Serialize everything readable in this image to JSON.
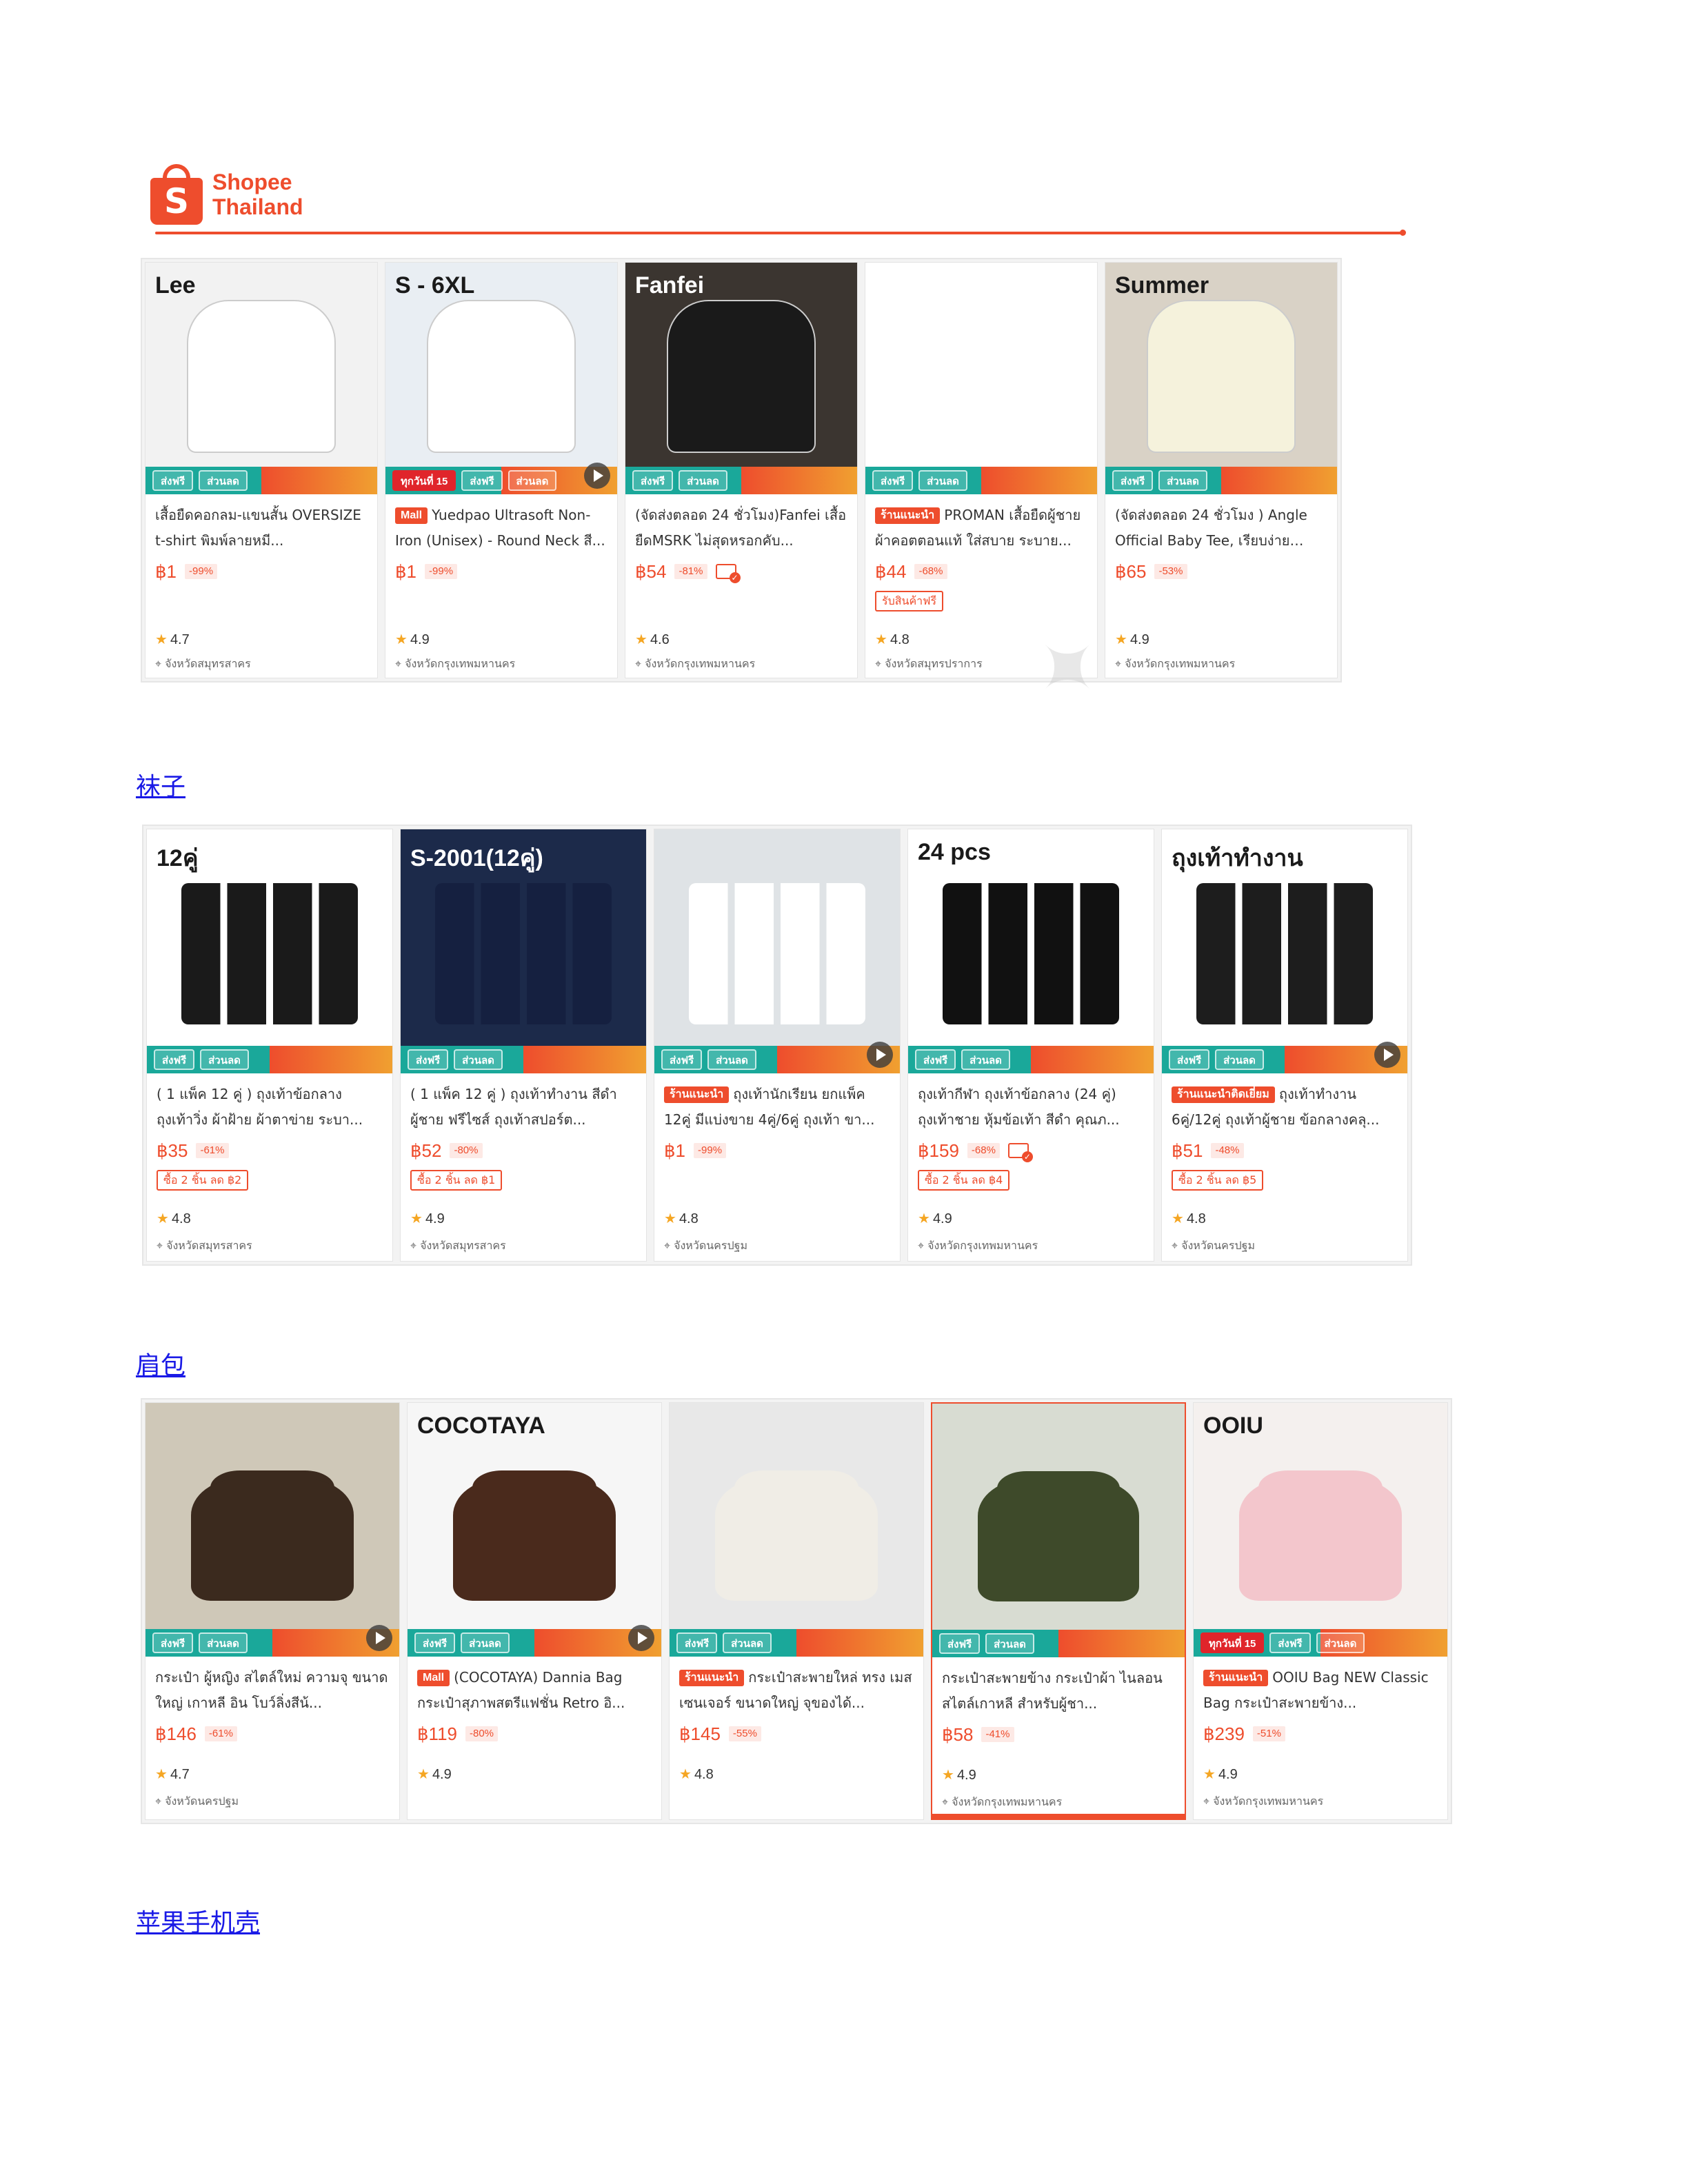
{
  "brand": {
    "logo_glyph": "S",
    "line1": "Shopee",
    "line2": "Thailand",
    "color": "#ee4d2d"
  },
  "promo_badges": {
    "free_ship": "ส่งฟรี",
    "discount": "ส่วนลด",
    "day15": "ทุกวันที่ 15"
  },
  "sections": [
    {
      "heading": "",
      "products": [
        {
          "title": "เสื้อยืดคอกลม-แขนสั้น OVERSIZE t-shirt พิมพ์ลายหมี...",
          "tag": "",
          "price": "฿1",
          "discount": "-99%",
          "installment": false,
          "voucher": "",
          "rating": "4.7",
          "location": "จังหวัดสมุทรสาคร",
          "caption": "Lee",
          "play": false,
          "day_badge": false
        },
        {
          "title": "Yuedpao Ultrasoft Non-Iron (Unisex) - Round Neck สี...",
          "tag": "Mall",
          "price": "฿1",
          "discount": "-99%",
          "installment": false,
          "voucher": "",
          "rating": "4.9",
          "location": "จังหวัดกรุงเทพมหานคร",
          "caption": "S - 6XL",
          "play": true,
          "day_badge": true
        },
        {
          "title": "(จัดส่งตลอด 24 ชั่วโมง)Fanfei เสื้อยืดMSRK ไม่สุดหรอกคับ...",
          "tag": "",
          "price": "฿54",
          "discount": "-81%",
          "installment": true,
          "voucher": "",
          "rating": "4.6",
          "location": "จังหวัดกรุงเทพมหานคร",
          "caption": "Fanfei",
          "play": false,
          "day_badge": false
        },
        {
          "title": "PROMAN เสื้อยืดผู้ชาย ผ้าคอตตอนแท้ ใส่สบาย ระบาย...",
          "tag": "ร้านแนะนำ",
          "price": "฿44",
          "discount": "-68%",
          "installment": false,
          "voucher": "รับสินค้าฟรี",
          "rating": "4.8",
          "location": "จังหวัดสมุทรปราการ",
          "caption": "",
          "play": false,
          "day_badge": false
        },
        {
          "title": "(จัดส่งตลอด 24 ชั่วโมง ) Angle Official Baby Tee, เรียบง่ายและ...",
          "tag": "",
          "price": "฿65",
          "discount": "-53%",
          "installment": false,
          "voucher": "",
          "rating": "4.9",
          "location": "จังหวัดกรุงเทพมหานคร",
          "caption": "Summer",
          "play": false,
          "day_badge": false
        }
      ]
    },
    {
      "heading": "袜子",
      "products": [
        {
          "title": "( 1 แพ็ค 12 คู่ ) ถุงเท้าข้อกลาง ถุงเท้าวิ่ง ผ้าฝ้าย ผ้าตาข่าย ระบา...",
          "tag": "",
          "price": "฿35",
          "discount": "-61%",
          "installment": false,
          "voucher": "ซื้อ 2 ชิ้น ลด ฿2",
          "rating": "4.8",
          "location": "จังหวัดสมุทรสาคร",
          "caption": "12คู่",
          "play": false,
          "day_badge": false
        },
        {
          "title": "( 1 แพ็ค 12 คู่ ) ถุงเท้าทำงาน สีดำ ผู้ชาย ฟรีไซส์ ถุงเท้าสปอร์ต...",
          "tag": "",
          "price": "฿52",
          "discount": "-80%",
          "installment": false,
          "voucher": "ซื้อ 2 ชิ้น ลด ฿1",
          "rating": "4.9",
          "location": "จังหวัดสมุทรสาคร",
          "caption": "S-2001(12คู่)",
          "play": false,
          "day_badge": false
        },
        {
          "title": "ถุงเท้านักเรียน ยกแพ็ค 12คู่ มีแบ่งขาย 4คู่/6คู่ ถุงเท้า ขา...",
          "tag": "ร้านแนะนำ",
          "price": "฿1",
          "discount": "-99%",
          "installment": false,
          "voucher": "",
          "rating": "4.8",
          "location": "จังหวัดนครปฐม",
          "caption": "",
          "play": true,
          "day_badge": false
        },
        {
          "title": "ถุงเท้ากีฬา ถุงเท้าข้อกลาง (24 คู่) ถุงเท้าชาย หุ้มข้อเท้า สีดำ คุณภ...",
          "tag": "",
          "price": "฿159",
          "discount": "-68%",
          "installment": true,
          "voucher": "ซื้อ 2 ชิ้น ลด ฿4",
          "rating": "4.9",
          "location": "จังหวัดกรุงเทพมหานคร",
          "caption": "24 pcs",
          "play": false,
          "day_badge": false
        },
        {
          "title": "ถุงเท้าทำงาน 6คู่/12คู่ ถุงเท้าผู้ชาย ข้อกลางคลุ...",
          "tag": "ร้านแนะนำติดเยี่ยม",
          "price": "฿51",
          "discount": "-48%",
          "installment": false,
          "voucher": "ซื้อ 2 ชิ้น ลด ฿5",
          "rating": "4.8",
          "location": "จังหวัดนครปฐม",
          "caption": "ถุงเท้าทำงาน",
          "play": true,
          "day_badge": false
        }
      ]
    },
    {
      "heading": "肩包",
      "products": [
        {
          "title": "กระเป๋า ผู้หญิง สไตล์ใหม่ ความจุ ขนาดใหญ่ เกาหลี อิน โบว์ลิ่งสีน้...",
          "tag": "",
          "price": "฿146",
          "discount": "-61%",
          "installment": false,
          "voucher": "",
          "rating": "4.7",
          "location": "จังหวัดนครปฐม",
          "caption": "",
          "play": true,
          "day_badge": false
        },
        {
          "title": "(COCOTAYA) Dannia Bag กระเป๋าสุภาพสตรีแฟชั่น Retro อิ...",
          "tag": "Mall",
          "price": "฿119",
          "discount": "-80%",
          "installment": false,
          "voucher": "",
          "rating": "4.9",
          "location": "",
          "caption": "COCOTAYA",
          "play": true,
          "day_badge": false
        },
        {
          "title": "กระเป๋าสะพายใหล่ ทรง เมสเซนเจอร์ ขนาดใหญ่ จุของได้...",
          "tag": "ร้านแนะนำ",
          "price": "฿145",
          "discount": "-55%",
          "installment": false,
          "voucher": "",
          "rating": "4.8",
          "location": "",
          "caption": "",
          "play": false,
          "day_badge": false
        },
        {
          "title": "กระเป๋าสะพายข้าง กระเป๋าผ้า ไนลอน สไตล์เกาหลี สำหรับผู้ชา...",
          "tag": "",
          "price": "฿58",
          "discount": "-41%",
          "installment": false,
          "voucher": "",
          "rating": "4.9",
          "location": "จังหวัดกรุงเทพมหานคร",
          "caption": "",
          "play": false,
          "day_badge": false
        },
        {
          "title": "OOIU Bag NEW Classic Bag กระเป๋าสะพายข้าง...",
          "tag": "ร้านแนะนำ",
          "price": "฿239",
          "discount": "-51%",
          "installment": false,
          "voucher": "",
          "rating": "4.9",
          "location": "จังหวัดกรุงเทพมหานคร",
          "caption": "OOIU",
          "play": false,
          "day_badge": true
        }
      ]
    },
    {
      "heading": "苹果手机壳",
      "products": []
    }
  ]
}
